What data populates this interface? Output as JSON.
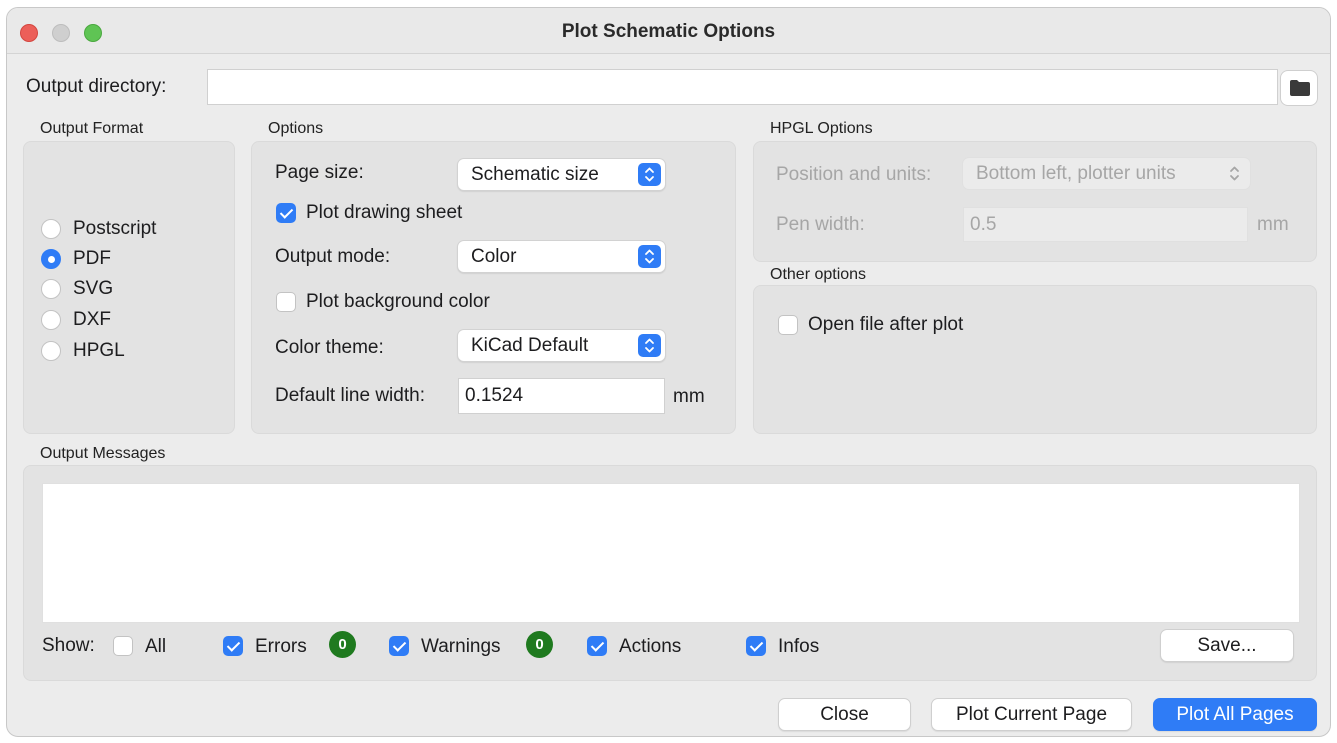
{
  "window": {
    "title": "Plot Schematic Options"
  },
  "output_directory": {
    "label": "Output directory:",
    "value": ""
  },
  "output_format": {
    "heading": "Output Format",
    "options": [
      {
        "label": "Postscript",
        "selected": false
      },
      {
        "label": "PDF",
        "selected": true
      },
      {
        "label": "SVG",
        "selected": false
      },
      {
        "label": "DXF",
        "selected": false
      },
      {
        "label": "HPGL",
        "selected": false
      }
    ]
  },
  "options": {
    "heading": "Options",
    "page_size_label": "Page size:",
    "page_size_value": "Schematic size",
    "plot_drawing_sheet_label": "Plot drawing sheet",
    "plot_drawing_sheet_checked": true,
    "output_mode_label": "Output mode:",
    "output_mode_value": "Color",
    "plot_background_label": "Plot background color",
    "plot_background_checked": false,
    "color_theme_label": "Color theme:",
    "color_theme_value": "KiCad Default",
    "line_width_label": "Default line width:",
    "line_width_value": "0.1524",
    "line_width_unit": "mm"
  },
  "hpgl": {
    "heading": "HPGL Options",
    "position_label": "Position and units:",
    "position_value": "Bottom left, plotter units",
    "pen_width_label": "Pen width:",
    "pen_width_value": "0.5",
    "pen_width_unit": "mm"
  },
  "other": {
    "heading": "Other options",
    "open_after_plot_label": "Open file after plot",
    "open_after_plot_checked": false
  },
  "messages": {
    "heading": "Output Messages",
    "show_label": "Show:",
    "all_label": "All",
    "errors_label": "Errors",
    "errors_count": "0",
    "warnings_label": "Warnings",
    "warnings_count": "0",
    "actions_label": "Actions",
    "infos_label": "Infos",
    "save_label": "Save..."
  },
  "footer": {
    "close_label": "Close",
    "plot_current_label": "Plot Current Page",
    "plot_all_label": "Plot All Pages"
  },
  "colors": {
    "accent": "#2f7cf6",
    "badge": "#1f7a1f",
    "close_light": "#ec5f59",
    "zoom_light": "#5fc454"
  }
}
